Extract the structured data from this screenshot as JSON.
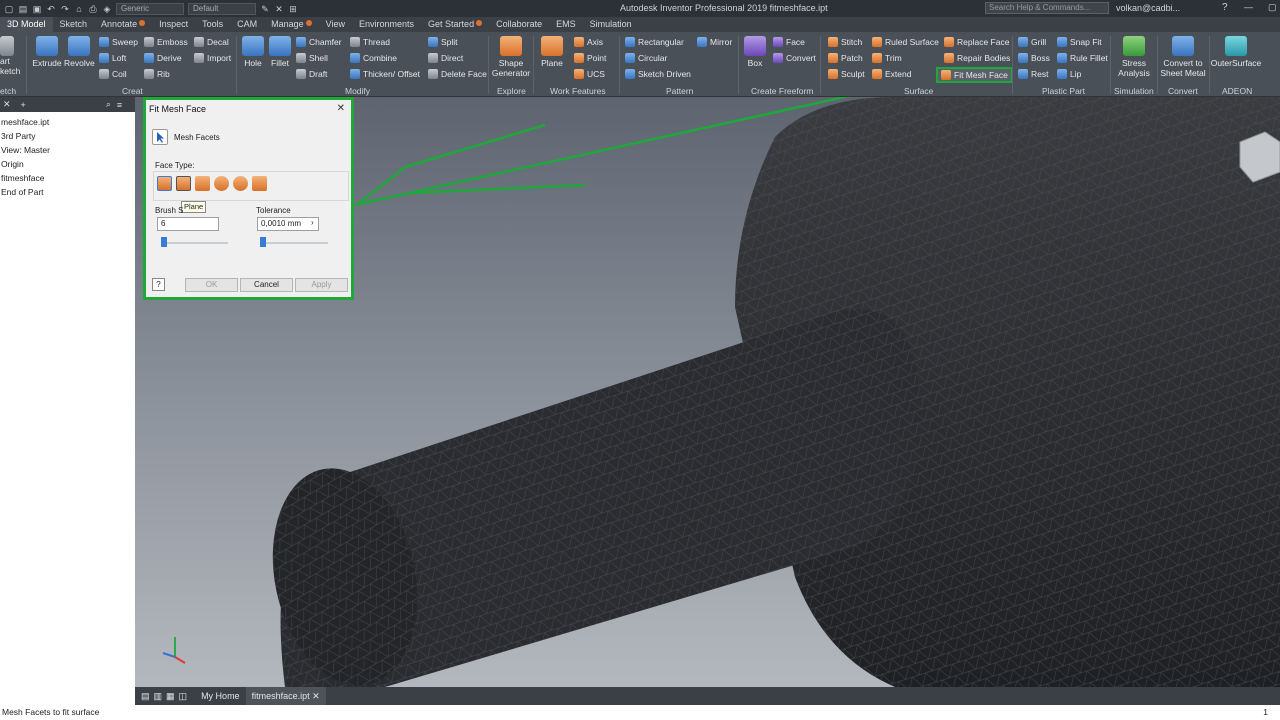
{
  "window": {
    "title": "Autodesk Inventor Professional 2019   fitmeshface.ipt",
    "search_placeholder": "Search Help & Commands...",
    "user": "volkan@cadbi...",
    "material_combo": "Generic",
    "appearance_combo": "Default"
  },
  "ribbon_tabs": [
    "3D Model",
    "Sketch",
    "Annotate",
    "Inspect",
    "Tools",
    "CAM",
    "Manage",
    "View",
    "Environments",
    "Get Started",
    "Collaborate",
    "EMS",
    "Simulation"
  ],
  "ribbon": {
    "left_cut": {
      "line1": "art",
      "line2": "ketch",
      "panel": "etch"
    },
    "create": {
      "extrude": "Extrude",
      "revolve": "Revolve",
      "sweep": "Sweep",
      "loft": "Loft",
      "coil": "Coil",
      "emboss": "Emboss",
      "derive": "Derive",
      "rib": "Rib",
      "decal": "Decal",
      "import": "Import",
      "panel": "Creat"
    },
    "modify": {
      "hole": "Hole",
      "fillet": "Fillet",
      "chamfer": "Chamfer",
      "shell": "Shell",
      "draft": "Draft",
      "thread": "Thread",
      "combine": "Combine",
      "thicken": "Thicken/ Offset",
      "split": "Split",
      "direct": "Direct",
      "delete_face": "Delete Face",
      "panel": "Modify"
    },
    "explore": {
      "shape_generator_1": "Shape",
      "shape_generator_2": "Generator",
      "panel": "Explore"
    },
    "work_features": {
      "plane": "Plane",
      "axis": "Axis",
      "point": "Point",
      "ucs": "UCS",
      "panel": "Work Features"
    },
    "pattern": {
      "rectangular": "Rectangular",
      "circular": "Circular",
      "sketch_driven": "Sketch Driven",
      "mirror": "Mirror",
      "panel": "Pattern"
    },
    "freeform": {
      "box": "Box",
      "face": "Face",
      "convert": "Convert",
      "panel": "Create Freeform"
    },
    "surface": {
      "stitch": "Stitch",
      "patch": "Patch",
      "sculpt": "Sculpt",
      "ruled_surface": "Ruled Surface",
      "trim": "Trim",
      "extend": "Extend",
      "replace_face": "Replace Face",
      "repair_bodies": "Repair Bodies",
      "fit_mesh_face": "Fit Mesh Face",
      "panel": "Surface"
    },
    "plastic_part": {
      "grill": "Grill",
      "boss": "Boss",
      "rest": "Rest",
      "snap_fit": "Snap Fit",
      "rule_fillet": "Rule Fillet",
      "lip": "Lip",
      "panel": "Plastic Part"
    },
    "simulation": {
      "stress_1": "Stress",
      "stress_2": "Analysis",
      "panel": "Simulation"
    },
    "convert": {
      "sheet_1": "Convert to",
      "sheet_2": "Sheet Metal",
      "panel": "Convert"
    },
    "adeon": {
      "outer": "OuterSurface",
      "panel": "ADEON"
    }
  },
  "browser": {
    "items": [
      "meshface.ipt",
      "3rd Party",
      "View: Master",
      "Origin",
      "fitmeshface",
      "End of Part"
    ]
  },
  "dialog": {
    "title": "Fit Mesh Face",
    "mesh_facets_label": "Mesh Facets",
    "face_type_label": "Face Type:",
    "tooltip": "Plane",
    "brush_size_label": "Brush S",
    "brush_size_value": "6",
    "tolerance_label": "Tolerance",
    "tolerance_value": "0,0010 mm",
    "ok": "OK",
    "cancel": "Cancel",
    "apply": "Apply"
  },
  "doc_tabs": {
    "home": "My Home",
    "file": "fitmeshface.ipt"
  },
  "status": {
    "text": "Mesh Facets to fit surface",
    "count": "1"
  },
  "colors": {
    "highlight_green": "#1fa83a",
    "ribbon_bg": "#4a5058",
    "titlebar_bg": "#2c3137"
  }
}
